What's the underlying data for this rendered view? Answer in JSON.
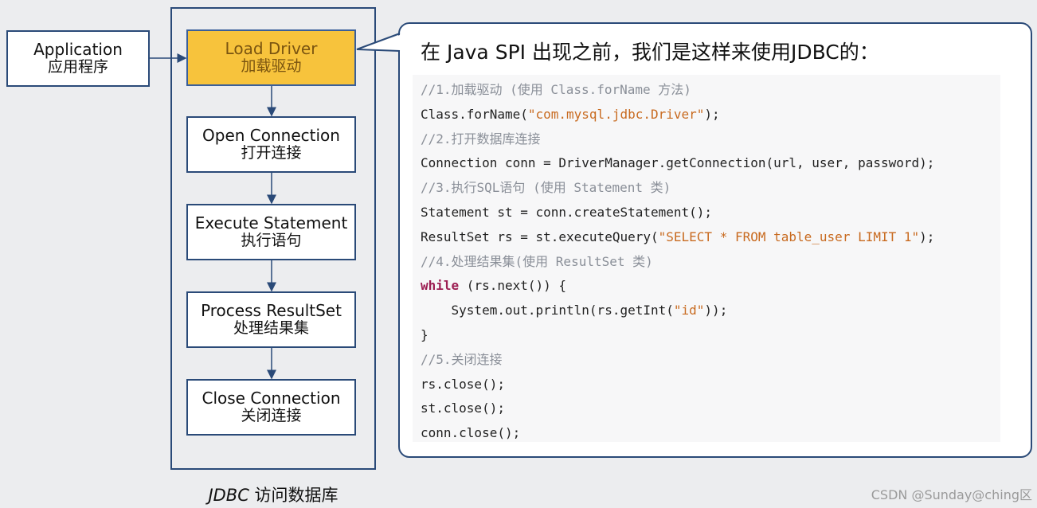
{
  "application": {
    "en": "Application",
    "zh": "应用程序"
  },
  "jdbc_steps": [
    {
      "en": "Load Driver",
      "zh": "加载驱动",
      "highlight": true
    },
    {
      "en": "Open Connection",
      "zh": "打开连接",
      "highlight": false
    },
    {
      "en": "Execute Statement",
      "zh": "执行语句",
      "highlight": false
    },
    {
      "en": "Process ResultSet",
      "zh": "处理结果集",
      "highlight": false
    },
    {
      "en": "Close Connection",
      "zh": "关闭连接",
      "highlight": false
    }
  ],
  "jdbc_caption": {
    "italic": "JDBC",
    "rest": " 访问数据库"
  },
  "callout": {
    "title": "在 Java SPI 出现之前，我们是这样来使用JDBC的：",
    "code_lines": [
      {
        "type": "comment",
        "text": "//1.加载驱动 (使用 Class.forName 方法)"
      },
      {
        "type": "code",
        "parts": [
          {
            "t": "Class.forName("
          },
          {
            "t": "\"com.mysql.jdbc.Driver\"",
            "c": "str"
          },
          {
            "t": ");"
          }
        ]
      },
      {
        "type": "comment",
        "text": "//2.打开数据库连接"
      },
      {
        "type": "code",
        "parts": [
          {
            "t": "Connection conn = DriverManager.getConnection(url, user, password);"
          }
        ]
      },
      {
        "type": "comment",
        "text": "//3.执行SQL语句 (使用 Statement 类)"
      },
      {
        "type": "code",
        "parts": [
          {
            "t": "Statement st = conn.createStatement();"
          }
        ]
      },
      {
        "type": "code",
        "parts": [
          {
            "t": "ResultSet rs = st.executeQuery("
          },
          {
            "t": "\"SELECT * FROM table_user LIMIT 1\"",
            "c": "str"
          },
          {
            "t": ");"
          }
        ]
      },
      {
        "type": "comment",
        "text": "//4.处理结果集(使用 ResultSet 类)"
      },
      {
        "type": "code",
        "parts": [
          {
            "t": "while",
            "c": "kw"
          },
          {
            "t": " (rs.next()) {"
          }
        ]
      },
      {
        "type": "code",
        "parts": [
          {
            "t": "    System.out.println(rs.getInt("
          },
          {
            "t": "\"id\"",
            "c": "str"
          },
          {
            "t": "));"
          }
        ]
      },
      {
        "type": "code",
        "parts": [
          {
            "t": "}"
          }
        ]
      },
      {
        "type": "comment",
        "text": "//5.关闭连接"
      },
      {
        "type": "code",
        "parts": [
          {
            "t": "rs.close();"
          }
        ]
      },
      {
        "type": "code",
        "parts": [
          {
            "t": "st.close();"
          }
        ]
      },
      {
        "type": "code",
        "parts": [
          {
            "t": "conn.close();"
          }
        ]
      }
    ]
  },
  "watermark": "CSDN @Sunday@ching区",
  "colors": {
    "border": "#2a4a78",
    "highlight_fill": "#f7c33c",
    "highlight_text": "#7a5410",
    "string_literal": "#c86a1f",
    "keyword": "#9c1d52",
    "comment": "#8a8f98",
    "background": "#ecedef"
  }
}
